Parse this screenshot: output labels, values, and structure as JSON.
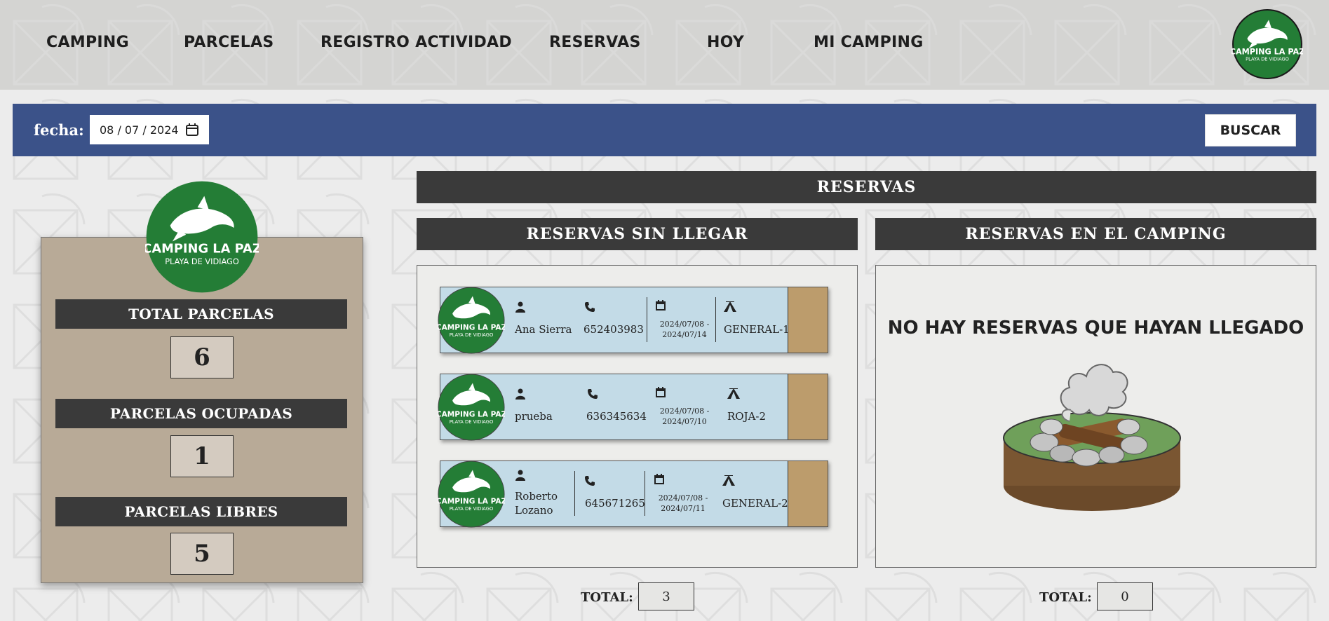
{
  "nav": {
    "links": [
      "CAMPING",
      "PARCELAS",
      "REGISTRO ACTIVIDAD",
      "RESERVAS",
      "HOY",
      "MI CAMPING"
    ],
    "logo_icon": "dolphin-logo-icon"
  },
  "logo": {
    "line1": "CAMPING LA PAZ",
    "line2": "PLAYA DE VIDIAGO"
  },
  "search": {
    "label": "fecha:",
    "date_value": "08 / 07 / 2024",
    "button": "BUSCAR"
  },
  "stats": {
    "total": {
      "label": "TOTAL PARCELAS",
      "value": "6"
    },
    "ocupadas": {
      "label": "PARCELAS OCUPADAS",
      "value": "1"
    },
    "libres": {
      "label": "PARCELAS LIBRES",
      "value": "5"
    }
  },
  "reservas": {
    "title": "RESERVAS",
    "sin_llegar": {
      "title": "RESERVAS SIN LLEGAR",
      "items": [
        {
          "name": "Ana Sierra",
          "phone": "652403983",
          "date_from": "2024/07/08 -",
          "date_to": "2024/07/14",
          "plot": "GENERAL-1"
        },
        {
          "name": "prueba",
          "phone": "636345634",
          "date_from": "2024/07/08 -",
          "date_to": "2024/07/10",
          "plot": "ROJA-2"
        },
        {
          "name_line1": "Roberto",
          "name_line2": "Lozano",
          "phone": "645671265",
          "date_from": "2024/07/08 -",
          "date_to": "2024/07/11",
          "plot": "GENERAL-2"
        }
      ],
      "total_label": "TOTAL:",
      "total": "3"
    },
    "en_camping": {
      "title": "RESERVAS EN EL CAMPING",
      "empty_message": "NO HAY RESERVAS QUE HAYAN LLEGADO",
      "total_label": "TOTAL:",
      "total": "0"
    }
  },
  "colors": {
    "nav_bg": "#d4d4d2",
    "search_bar": "#3b5289",
    "dark_header": "#3a3a3a",
    "logo_green": "#247d36",
    "card_blue": "#c3dbe7",
    "card_tan": "#bc9c6c",
    "panel_tan": "#b8aa97"
  }
}
